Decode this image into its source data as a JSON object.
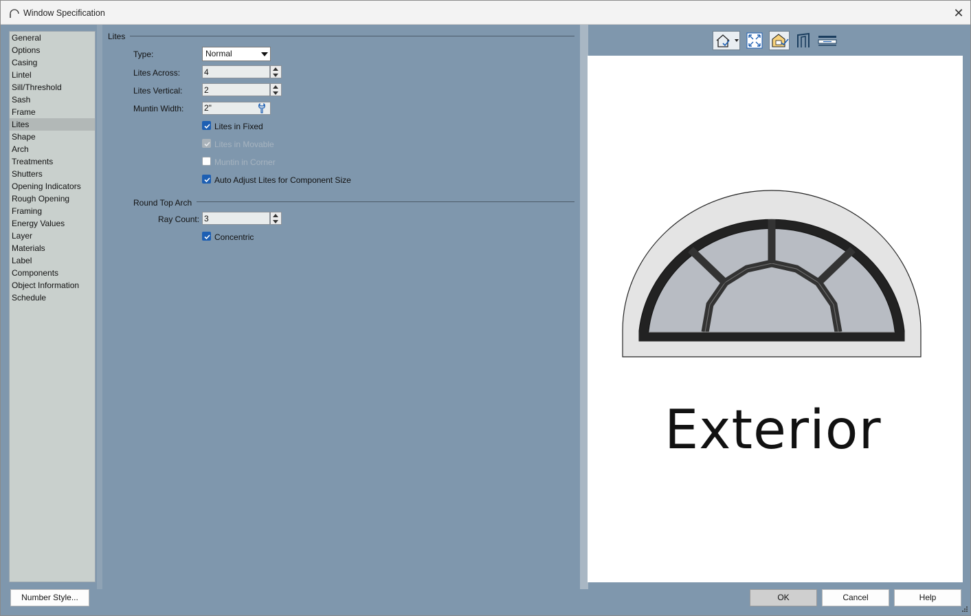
{
  "window": {
    "title": "Window Specification",
    "close_glyph": "✕"
  },
  "nav": {
    "items": [
      "General",
      "Options",
      "Casing",
      "Lintel",
      "Sill/Threshold",
      "Sash",
      "Frame",
      "Lites",
      "Shape",
      "Arch",
      "Treatments",
      "Shutters",
      "Opening Indicators",
      "Rough Opening",
      "Framing",
      "Energy Values",
      "Layer",
      "Materials",
      "Label",
      "Components",
      "Object Information",
      "Schedule"
    ],
    "selected": "Lites"
  },
  "lites": {
    "section_title": "Lites",
    "type_label": "Type:",
    "type_value": "Normal",
    "lites_across_label": "Lites Across:",
    "lites_across_value": "4",
    "lites_vertical_label": "Lites Vertical:",
    "lites_vertical_value": "2",
    "muntin_width_label": "Muntin Width:",
    "muntin_width_value": "2\"",
    "lites_in_fixed": {
      "label": "Lites in Fixed",
      "checked": true,
      "enabled": true
    },
    "lites_in_movable": {
      "label": "Lites in Movable",
      "checked": true,
      "enabled": false
    },
    "muntin_in_corner": {
      "label": "Muntin in Corner",
      "checked": false,
      "enabled": false
    },
    "auto_adjust": {
      "label": "Auto Adjust Lites for Component Size",
      "checked": true,
      "enabled": true
    }
  },
  "round_top_arch": {
    "section_title": "Round Top Arch",
    "ray_count_label": "Ray Count:",
    "ray_count_value": "3",
    "concentric": {
      "label": "Concentric",
      "checked": true
    }
  },
  "preview": {
    "caption": "Exterior",
    "toolbar_icons": [
      "view-options-icon",
      "fill-window-icon",
      "render-options-icon",
      "side-view-icon",
      "plan-view-icon"
    ]
  },
  "buttons": {
    "number_style": "Number Style...",
    "ok": "OK",
    "cancel": "Cancel",
    "help": "Help"
  },
  "colors": {
    "panel_bg": "#7f97ad",
    "nav_bg": "#c9d0cd",
    "checkbox_blue": "#1d5fb3"
  }
}
